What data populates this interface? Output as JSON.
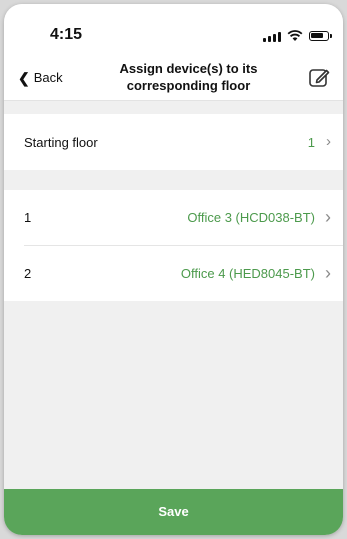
{
  "status_bar": {
    "time": "4:15"
  },
  "nav": {
    "back_label": "Back",
    "title_line1": "Assign device(s) to its",
    "title_line2": "corresponding floor",
    "edit_icon": "edit-icon"
  },
  "starting_floor": {
    "label": "Starting floor",
    "value": "1"
  },
  "floors": [
    {
      "label": "1",
      "device": "Office 3 (HCD038-BT)"
    },
    {
      "label": "2",
      "device": "Office 4 (HED8045-BT)"
    }
  ],
  "save_label": "Save",
  "colors": {
    "accent_green": "#5aa55a",
    "value_green": "#4c9a4c"
  }
}
